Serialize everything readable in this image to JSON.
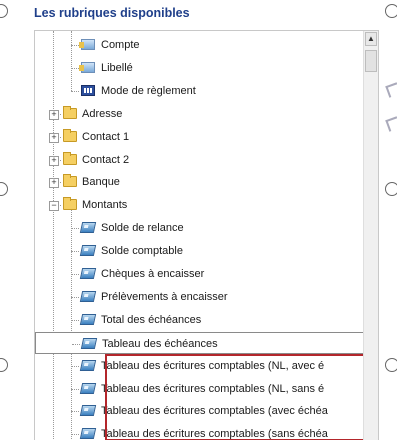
{
  "header": {
    "title": "Les rubriques disponibles"
  },
  "tree": {
    "items": [
      {
        "label": "Compte",
        "icon": "field-icon",
        "level": 2
      },
      {
        "label": "Libellé",
        "icon": "field-icon",
        "level": 2
      },
      {
        "label": "Mode de règlement",
        "icon": "table-icon",
        "level": 2
      },
      {
        "label": "Adresse",
        "icon": "folder-icon",
        "level": 1,
        "expander": "+"
      },
      {
        "label": "Contact 1",
        "icon": "folder-icon",
        "level": 1,
        "expander": "+"
      },
      {
        "label": "Contact 2",
        "icon": "folder-icon",
        "level": 1,
        "expander": "+"
      },
      {
        "label": "Banque",
        "icon": "folder-icon",
        "level": 1,
        "expander": "+"
      },
      {
        "label": "Montants",
        "icon": "folder-icon",
        "level": 1,
        "expander": "−"
      },
      {
        "label": "Solde de relance",
        "icon": "calc-icon",
        "level": 2
      },
      {
        "label": "Solde comptable",
        "icon": "calc-icon",
        "level": 2
      },
      {
        "label": "Chèques à encaisser",
        "icon": "calc-icon",
        "level": 2
      },
      {
        "label": "Prélèvements à encaisser",
        "icon": "calc-icon",
        "level": 2
      },
      {
        "label": "Total des échéances",
        "icon": "calc-icon",
        "level": 2
      },
      {
        "label": "Tableau des échéances",
        "icon": "calc-icon",
        "level": 2,
        "selected": true
      },
      {
        "label": "Tableau des écritures comptables (NL, avec é",
        "icon": "calc-icon",
        "level": 2
      },
      {
        "label": "Tableau des écritures comptables (NL, sans é",
        "icon": "calc-icon",
        "level": 2
      },
      {
        "label": "Tableau des écritures comptables (avec échéa",
        "icon": "calc-icon",
        "level": 2
      },
      {
        "label": "Tableau des écritures comptables (sans échéa",
        "icon": "calc-icon",
        "level": 2
      }
    ]
  },
  "scrollbar": {
    "up_arrow": "▲"
  },
  "colors": {
    "header": "#1f3f8a",
    "highlight": "#b3262b"
  }
}
